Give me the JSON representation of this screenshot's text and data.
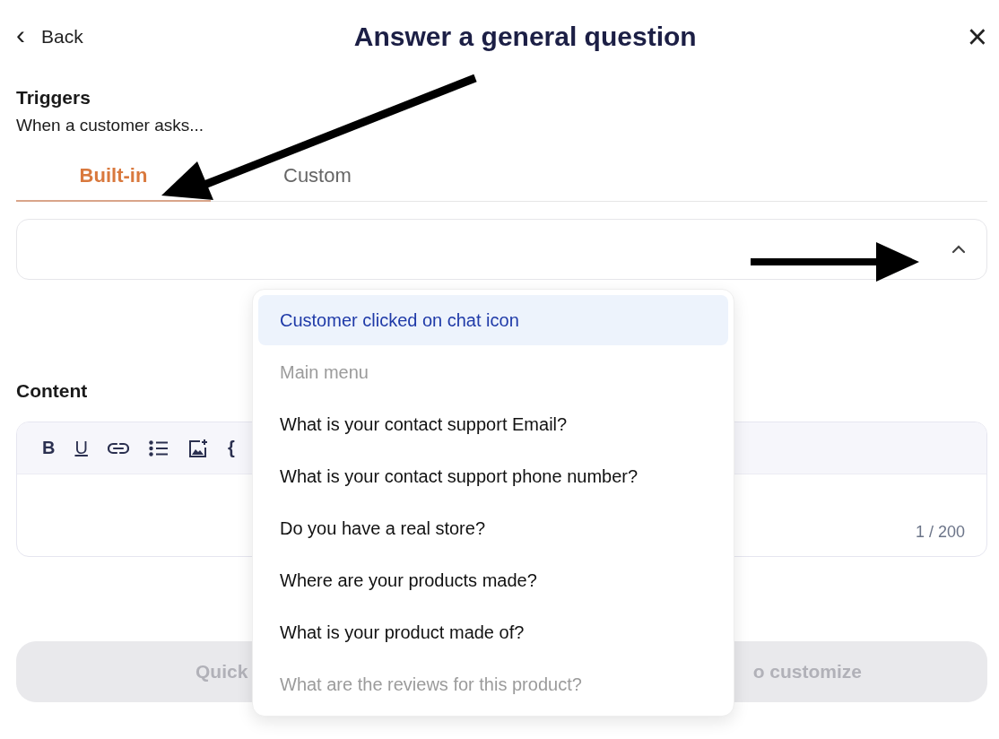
{
  "header": {
    "back": "Back",
    "back_glyph": "‹",
    "title": "Answer a general question",
    "close": "×"
  },
  "triggers": {
    "heading": "Triggers",
    "subtitle": "When a customer asks...",
    "tabs": [
      {
        "label": "Built-in",
        "selected": true
      },
      {
        "label": "Custom",
        "selected": false
      }
    ],
    "select": {
      "expanded": true
    },
    "options": [
      {
        "label": "Customer clicked on chat icon",
        "selected": true,
        "disabled": false
      },
      {
        "label": "Main menu",
        "selected": false,
        "disabled": true
      },
      {
        "label": "What is your contact support Email?",
        "selected": false,
        "disabled": false
      },
      {
        "label": "What is your contact support phone number?",
        "selected": false,
        "disabled": false
      },
      {
        "label": "Do you have a real store?",
        "selected": false,
        "disabled": false
      },
      {
        "label": "Where are your products made?",
        "selected": false,
        "disabled": false
      },
      {
        "label": "What is your product made of?",
        "selected": false,
        "disabled": false
      },
      {
        "label": "What are the reviews for this product?",
        "selected": false,
        "disabled": true
      }
    ]
  },
  "content": {
    "heading": "Content",
    "toolbar": [
      {
        "kind": "bold",
        "glyph": "B"
      },
      {
        "kind": "underline",
        "glyph": "U"
      },
      {
        "kind": "link"
      },
      {
        "kind": "list"
      },
      {
        "kind": "image"
      },
      {
        "kind": "code",
        "glyph": "{"
      }
    ],
    "counter": "1 / 200"
  },
  "action_button": {
    "label_start": "Quick",
    "label_end": "o customize",
    "disabled": true
  }
}
